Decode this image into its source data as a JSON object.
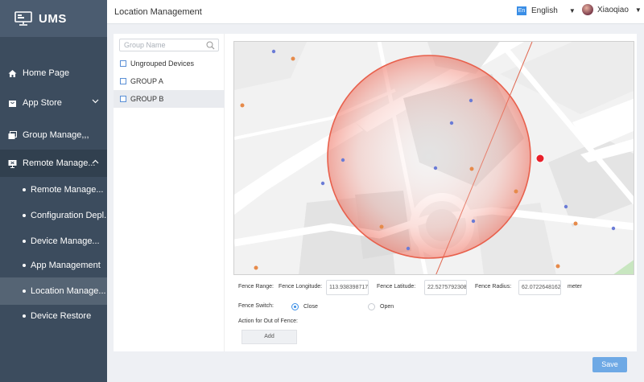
{
  "app": {
    "name": "UMS"
  },
  "sidebar": {
    "items": [
      {
        "label": "Home Page",
        "icon": "home-icon"
      },
      {
        "label": "App Store",
        "icon": "store-icon"
      },
      {
        "label": "Group Manage,,,",
        "icon": "group-icon"
      },
      {
        "label": "Remote Manage...",
        "icon": "remote-icon"
      }
    ],
    "subitems": [
      {
        "label": "Remote Manage..."
      },
      {
        "label": "Configuration Depl..."
      },
      {
        "label": "Device  Manage..."
      },
      {
        "label": "App Management"
      },
      {
        "label": "Location Manage..."
      },
      {
        "label": "Device Restore"
      }
    ]
  },
  "header": {
    "title": "Location Management",
    "language_badge": "En",
    "language": "English",
    "user_name": "Xiaoqiao"
  },
  "tree": {
    "search_placeholder": "Group Name",
    "nodes": [
      {
        "label": "Ungrouped Devices"
      },
      {
        "label": "GROUP A"
      },
      {
        "label": "GROUP B"
      }
    ]
  },
  "map": {
    "fence_color": "#e8604c",
    "marker_color": "#e8202a"
  },
  "fence": {
    "range_label": "Fence Range:",
    "longitude_label": "Fence Longitude:",
    "longitude_value": "113.938398717;",
    "latitude_label": "Fence Latitude:",
    "latitude_value": "22.5275792308",
    "radius_label": "Fence Radius:",
    "radius_value": "62.0722648162",
    "radius_unit": "meter",
    "switch_label": "Fence Switch:",
    "close_label": "Close",
    "open_label": "Open",
    "out_of_fence_label": "Action for Out of Fence:",
    "add_label": "Add",
    "switch_value": "Close"
  },
  "footer": {
    "save_label": "Save"
  },
  "colors": {
    "accent": "#3a8ee6",
    "sidebar": "#3c4c5e",
    "sidebar_selected": "#556474",
    "save": "#6ea9e5"
  }
}
